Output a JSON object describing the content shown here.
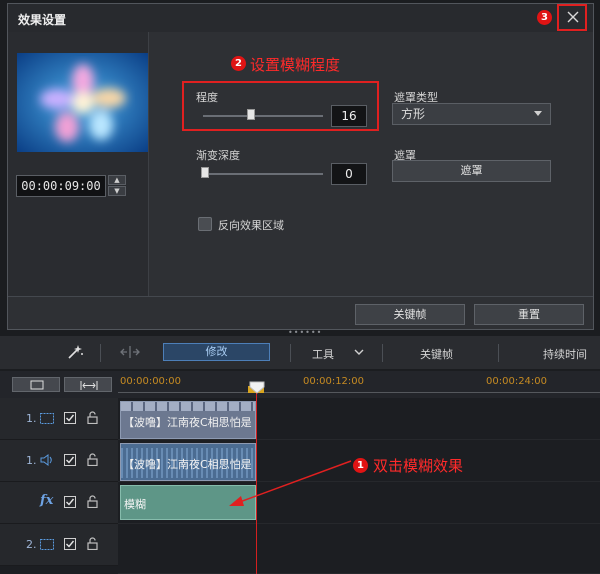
{
  "dialog": {
    "title": "效果设置",
    "timecode": "00:00:09:00",
    "degree_label": "程度",
    "degree_value": 16,
    "degree_fraction": 0.4,
    "feather_label": "渐变深度",
    "feather_value": 0,
    "feather_fraction": 0,
    "mask_type_label": "遮罩类型",
    "mask_type_value": "方形",
    "mask_label": "遮罩",
    "mask_button": "遮罩",
    "invert_label": "反向效果区域",
    "invert_checked": false,
    "keyframe_button": "关键帧",
    "reset_button": "重置"
  },
  "annotations": {
    "step1_number": "1",
    "step1_text": "双击模糊效果",
    "step2_number": "2",
    "step2_text": "设置模糊程度",
    "step3_number": "3"
  },
  "toolbar": {
    "modify": "修改",
    "tools": "工具",
    "keyframe": "关键帧",
    "duration": "持续时间"
  },
  "ruler": {
    "t0": "00:00:00:00",
    "t1": "00:00:12:00",
    "t2": "00:00:24:00"
  },
  "tracks": {
    "video_num": "1.",
    "audio_num": "1.",
    "fx_label": "fx",
    "track2_num": "2.",
    "video_clip": "【波噜】江南夜C相思怕是",
    "audio_clip": "【波噜】江南夜C相思怕是",
    "fx_clip": "模糊"
  },
  "colors": {
    "accent_red": "#e02020",
    "active_blue": "#4d7fb8",
    "fx_clip": "#5e9687",
    "ruler_orange": "#c58a22"
  }
}
